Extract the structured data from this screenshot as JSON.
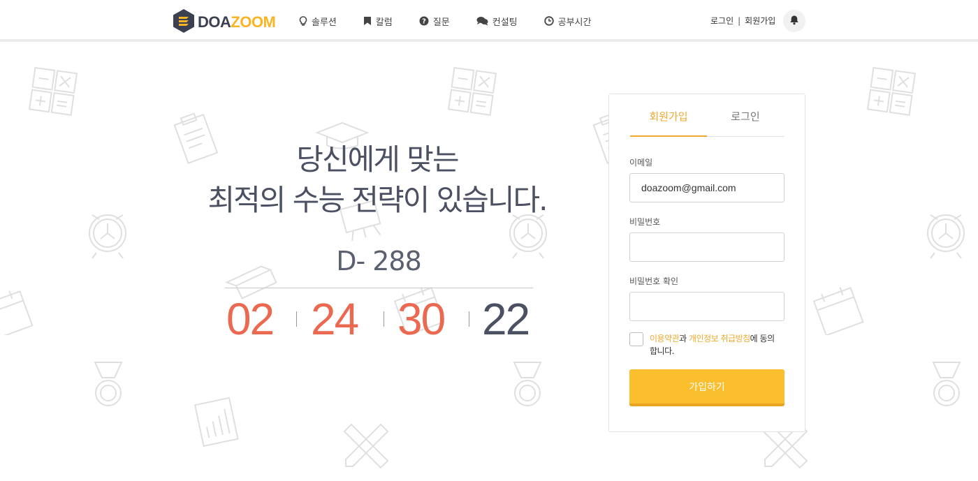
{
  "header": {
    "logo": {
      "part1": "DOA",
      "part2": "ZOOM"
    },
    "nav": [
      {
        "label": "솔루션",
        "icon": "lightbulb-icon"
      },
      {
        "label": "칼럼",
        "icon": "bookmark-icon"
      },
      {
        "label": "질문",
        "icon": "question-circle-icon"
      },
      {
        "label": "컨설팅",
        "icon": "chat-bubbles-icon"
      },
      {
        "label": "공부시간",
        "icon": "clock-icon"
      }
    ],
    "login_label": "로그인",
    "separator": "|",
    "signup_label": "회원가입",
    "notification_icon": "bell-icon"
  },
  "hero": {
    "title_line1": "당신에게 맞는",
    "title_line2": "최적의 수능 전략이 있습니다.",
    "dday": "D- 288",
    "counter": [
      "02",
      "24",
      "30",
      "22"
    ]
  },
  "form": {
    "tab_signup": "회원가입",
    "tab_login": "로그인",
    "email_label": "이메일",
    "email_value": "doazoom@gmail.com",
    "password_label": "비밀번호",
    "password_value": "",
    "password_confirm_label": "비밀번호 확인",
    "password_confirm_value": "",
    "agree_link1": "이용약관",
    "agree_text1": "과 ",
    "agree_link2": "개인정보 취급방침",
    "agree_text2": "에 동의합니다.",
    "submit_label": "가입하기"
  },
  "colors": {
    "accent": "#f0a92e",
    "button": "#fbbe2d",
    "counter_red": "#ea6950",
    "text_dark": "#4b5162"
  }
}
